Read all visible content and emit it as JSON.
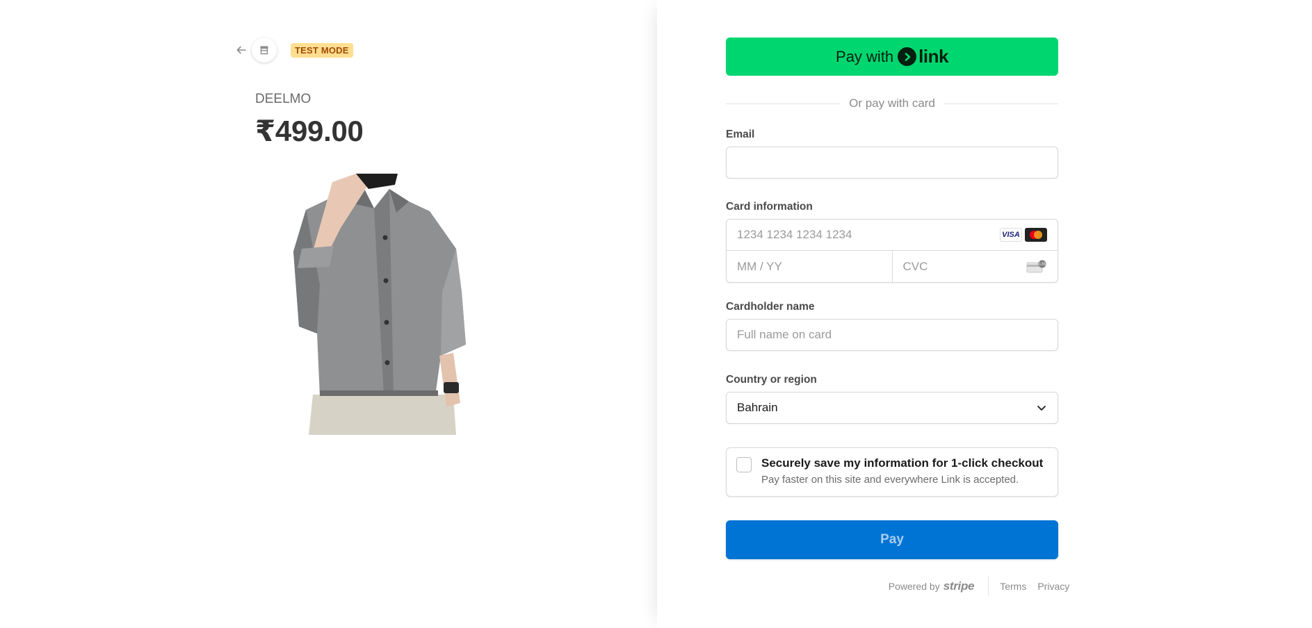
{
  "header": {
    "test_mode_badge": "TEST MODE"
  },
  "product": {
    "merchant": "DEELMO",
    "price": "₹499.00"
  },
  "checkout": {
    "link_button": {
      "prefix": "Pay with",
      "brand": "link"
    },
    "divider_text": "Or pay with card",
    "email": {
      "label": "Email",
      "value": ""
    },
    "card": {
      "label": "Card information",
      "number_placeholder": "1234 1234 1234 1234",
      "expiry_placeholder": "MM / YY",
      "cvc_placeholder": "CVC",
      "brands": [
        "VISA",
        "mastercard"
      ]
    },
    "cardholder": {
      "label": "Cardholder name",
      "placeholder": "Full name on card"
    },
    "country": {
      "label": "Country or region",
      "selected": "Bahrain"
    },
    "save_info": {
      "title": "Securely save my information for 1-click checkout",
      "subtitle": "Pay faster on this site and everywhere Link is accepted.",
      "checked": false
    },
    "pay_button": "Pay"
  },
  "footer": {
    "powered_by": "Powered by",
    "brand": "stripe",
    "links": [
      "Terms",
      "Privacy"
    ]
  },
  "colors": {
    "link_green": "#00d66f",
    "pay_blue": "#0074d4",
    "test_mode_bg": "#ffde92",
    "test_mode_text": "#a04b00"
  },
  "icons": [
    "back-arrow-icon",
    "store-icon",
    "link-arrow-icon",
    "visa-icon",
    "mastercard-icon",
    "cvc-card-icon",
    "chevron-down-icon"
  ]
}
